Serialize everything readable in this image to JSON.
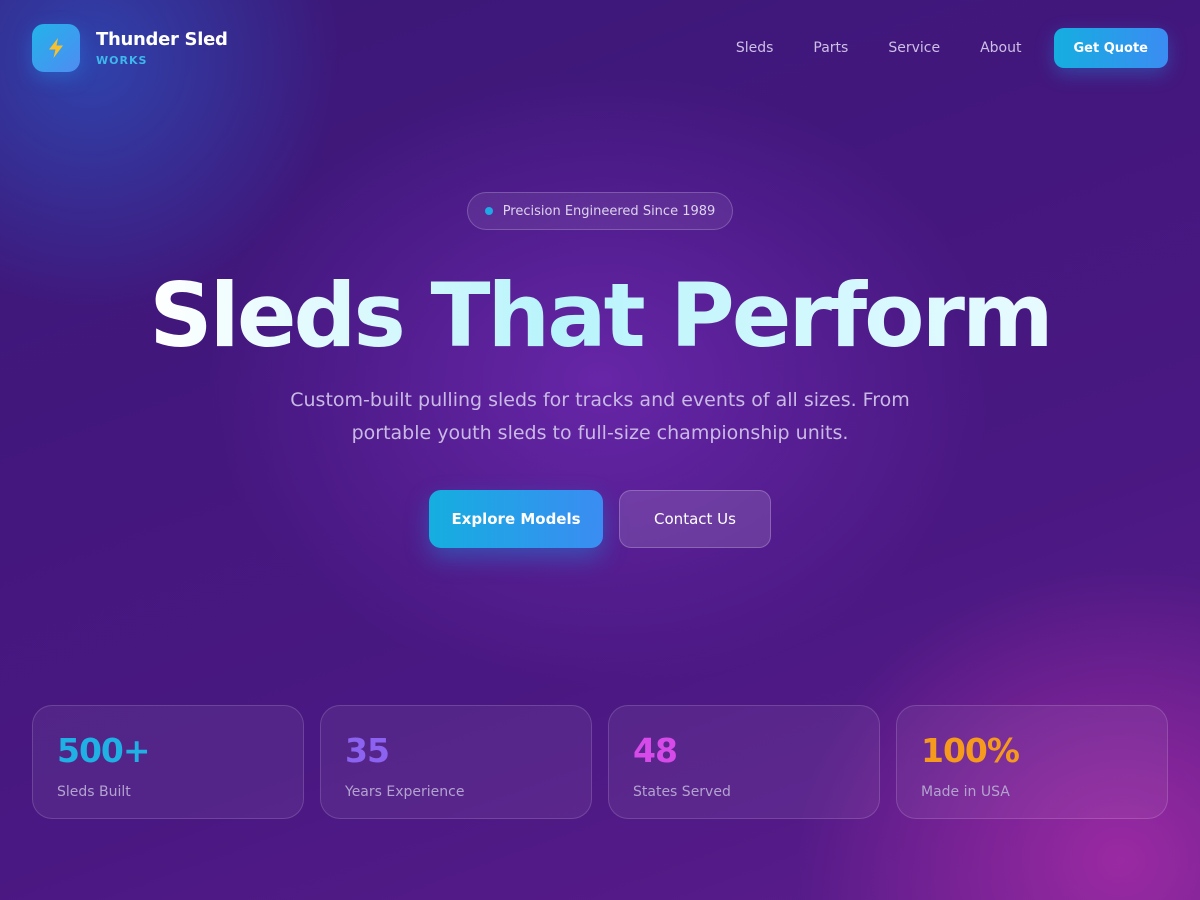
{
  "brand": {
    "name": "Thunder Sled",
    "subtitle": "WORKS",
    "logo_icon": "lightning-bolt-icon"
  },
  "nav": {
    "links": [
      "Sleds",
      "Parts",
      "Service",
      "About"
    ],
    "cta_label": "Get Quote"
  },
  "hero": {
    "badge_text": "Precision Engineered Since 1989",
    "headline": "Sleds That Perform",
    "subheadline": "Custom-built pulling sleds for tracks and events of all sizes. From portable youth sleds to full-size championship units.",
    "primary_button": "Explore Models",
    "secondary_button": "Contact Us"
  },
  "stats": [
    {
      "value": "500+",
      "label": "Sleds Built",
      "color": "#1fb0e4"
    },
    {
      "value": "35",
      "label": "Years Experience",
      "color": "#8c63f0"
    },
    {
      "value": "48",
      "label": "States Served",
      "color": "#d54ae8"
    },
    {
      "value": "100%",
      "label": "Made in USA",
      "color": "#f59a1c"
    }
  ],
  "colors": {
    "accent": "#1fa9e6",
    "background": "#44177e"
  }
}
